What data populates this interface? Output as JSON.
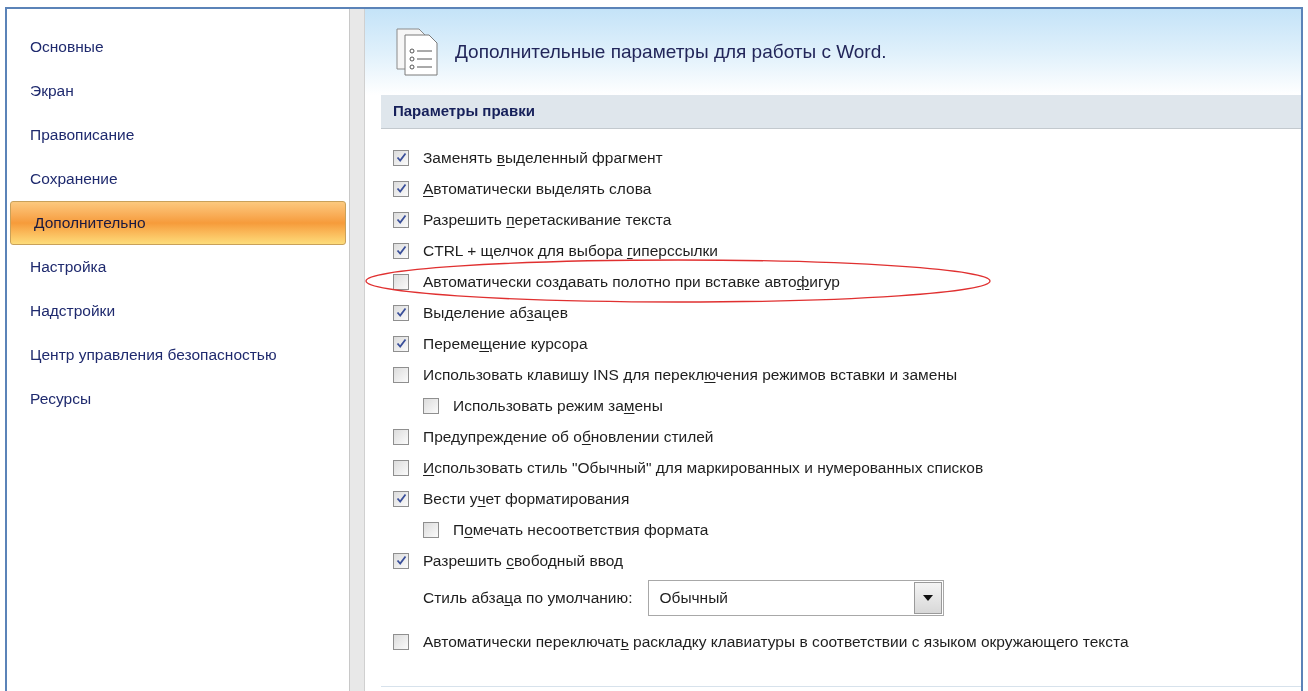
{
  "sidebar": {
    "items": [
      {
        "label": "Основные",
        "selected": false
      },
      {
        "label": "Экран",
        "selected": false
      },
      {
        "label": "Правописание",
        "selected": false
      },
      {
        "label": "Сохранение",
        "selected": false
      },
      {
        "label": "Дополнительно",
        "selected": true
      },
      {
        "label": "Настройка",
        "selected": false
      },
      {
        "label": "Надстройки",
        "selected": false
      },
      {
        "label": "Центр управления безопасностью",
        "selected": false
      },
      {
        "label": "Ресурсы",
        "selected": false
      }
    ]
  },
  "header": {
    "title": "Дополнительные параметры для работы с Word."
  },
  "section": {
    "title": "Параметры правки",
    "options": [
      {
        "kind": "checkbox",
        "checked": true,
        "circled": false,
        "before": "Заменять ",
        "key": "в",
        "after": "ыделенный фрагмент"
      },
      {
        "kind": "checkbox",
        "checked": true,
        "circled": false,
        "key": "А",
        "after": "втоматически выделять слова"
      },
      {
        "kind": "checkbox",
        "checked": true,
        "circled": false,
        "before": "Разрешить ",
        "key": "п",
        "after": "еретаскивание текста"
      },
      {
        "kind": "checkbox",
        "checked": true,
        "circled": false,
        "before": "CTRL + щелчок для выбора ",
        "key": "г",
        "after": "иперссылки"
      },
      {
        "kind": "checkbox",
        "checked": false,
        "circled": true,
        "before": "Автоматически создавать полотно при вставке авто",
        "key": "ф",
        "after": "игур"
      },
      {
        "kind": "checkbox",
        "checked": true,
        "circled": false,
        "before": "Выделение аб",
        "key": "з",
        "after": "ацев"
      },
      {
        "kind": "checkbox",
        "checked": true,
        "circled": false,
        "before": "Переме",
        "key": "щ",
        "after": "ение курсора"
      },
      {
        "kind": "checkbox",
        "checked": false,
        "circled": false,
        "before": "Использовать клавишу INS для перекл",
        "key": "ю",
        "after": "чения режимов вставки и замены"
      },
      {
        "kind": "subcheckbox",
        "checked": false,
        "circled": false,
        "before": "Использовать режим за",
        "key": "м",
        "after": "ены"
      },
      {
        "kind": "checkbox",
        "checked": false,
        "circled": false,
        "before": "Предупреждение об о",
        "key": "б",
        "after": "новлении стилей"
      },
      {
        "kind": "checkbox",
        "checked": false,
        "circled": false,
        "key": "И",
        "after": "спользовать стиль \"Обычный\" для маркированных и нумерованных списков"
      },
      {
        "kind": "checkbox",
        "checked": true,
        "circled": false,
        "before": "Вести у",
        "key": "ч",
        "after": "ет форматирования"
      },
      {
        "kind": "subcheckbox",
        "checked": false,
        "circled": false,
        "before": "П",
        "key": "о",
        "after": "мечать несоответствия формата"
      },
      {
        "kind": "checkbox",
        "checked": true,
        "circled": false,
        "before": "Разрешить ",
        "key": "с",
        "after": "вободный ввод"
      },
      {
        "kind": "select",
        "circled": false,
        "before": "Стиль абза",
        "key": "ц",
        "after": "а по умолчанию:",
        "value": "Обычный"
      },
      {
        "kind": "checkbox",
        "checked": false,
        "circled": false,
        "before": "Автоматически переключат",
        "key": "ь",
        "after": " раскладку клавиатуры в соответствии с языком окружающего текста"
      }
    ]
  }
}
